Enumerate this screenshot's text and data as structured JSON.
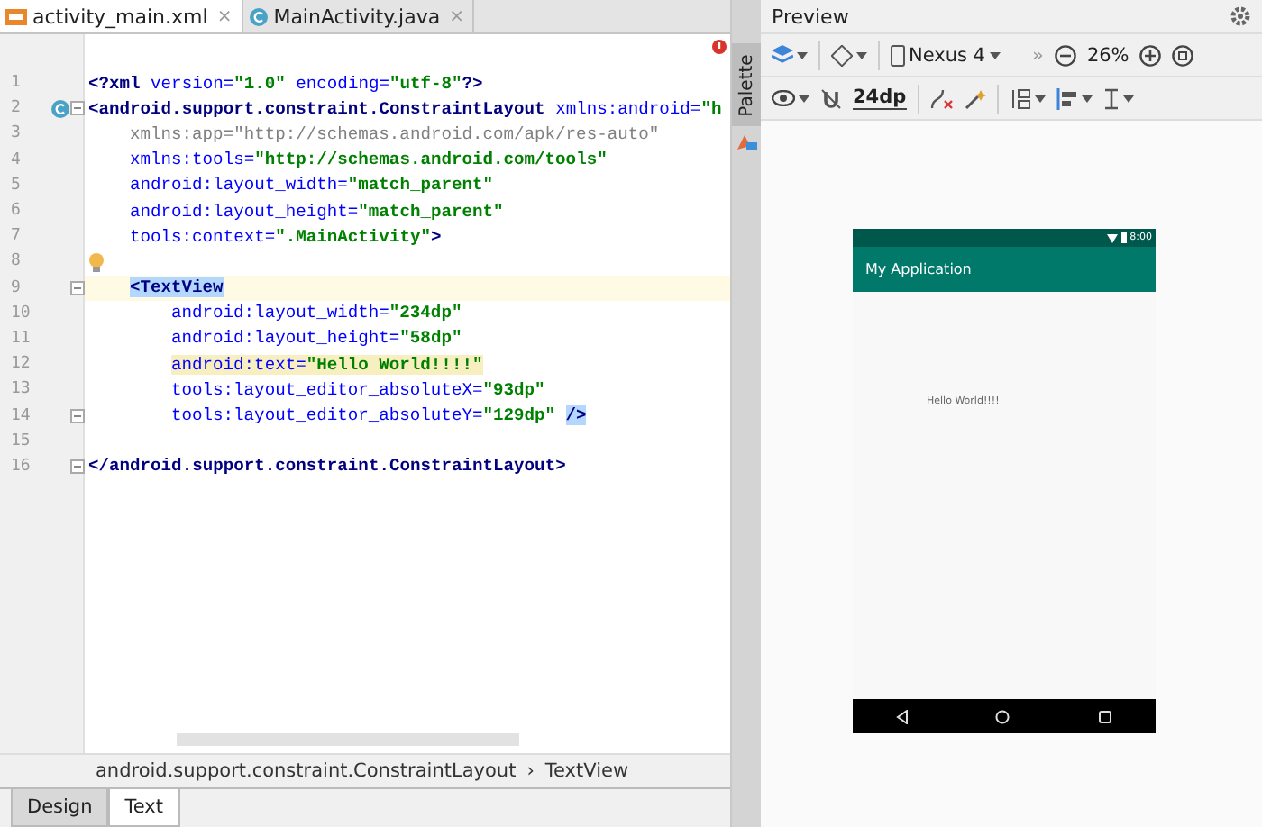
{
  "editor_tabs": [
    {
      "label": "activity_main.xml",
      "selected": true,
      "close": "×"
    },
    {
      "label": "MainActivity.java",
      "selected": false,
      "close": "×"
    }
  ],
  "code": {
    "lines": [
      {
        "number": "1",
        "kind": "root",
        "current": false,
        "class_marker": false,
        "fold": false,
        "bulb": false,
        "segments": [
          {
            "kind": "tag",
            "text": "<?xml "
          },
          {
            "kind": "attr",
            "text": "version="
          },
          {
            "kind": "value",
            "text": "\"1.0\" "
          },
          {
            "kind": "attr",
            "text": "encoding="
          },
          {
            "kind": "value",
            "text": "\"utf-8\""
          },
          {
            "kind": "tag",
            "text": "?>"
          }
        ]
      },
      {
        "number": "2",
        "kind": "root",
        "current": false,
        "class_marker": true,
        "fold": true,
        "bulb": false,
        "segments": [
          {
            "kind": "tag",
            "text": "<android.support.constraint.ConstraintLayout "
          },
          {
            "kind": "attr",
            "text": "xmlns:android="
          },
          {
            "kind": "value",
            "text": "\"h"
          }
        ]
      },
      {
        "number": "3",
        "kind": "attribute",
        "current": false,
        "class_marker": false,
        "fold": false,
        "bulb": false,
        "segments": [
          {
            "kind": "unused",
            "text": "xmlns:app=\"http://schemas.android.com/apk/res-auto\""
          }
        ]
      },
      {
        "number": "4",
        "kind": "attribute",
        "current": false,
        "class_marker": false,
        "fold": false,
        "bulb": false,
        "segments": [
          {
            "kind": "attr",
            "text": "xmlns:tools="
          },
          {
            "kind": "value",
            "text": "\"http://schemas.android.com/tools\""
          }
        ]
      },
      {
        "number": "5",
        "kind": "attribute",
        "current": false,
        "class_marker": false,
        "fold": false,
        "bulb": false,
        "segments": [
          {
            "kind": "attr",
            "text": "android:layout_width="
          },
          {
            "kind": "value",
            "text": "\"match_parent\""
          }
        ]
      },
      {
        "number": "6",
        "kind": "attribute",
        "current": false,
        "class_marker": false,
        "fold": false,
        "bulb": false,
        "segments": [
          {
            "kind": "attr",
            "text": "android:layout_height="
          },
          {
            "kind": "value",
            "text": "\"match_parent\""
          }
        ]
      },
      {
        "number": "7",
        "kind": "attribute",
        "current": false,
        "class_marker": false,
        "fold": false,
        "bulb": false,
        "segments": [
          {
            "kind": "attr",
            "text": "tools:context="
          },
          {
            "kind": "value",
            "text": "\".MainActivity\""
          },
          {
            "kind": "tag",
            "text": ">"
          }
        ]
      },
      {
        "number": "8",
        "kind": "blank",
        "current": false,
        "class_marker": false,
        "fold": false,
        "bulb": true
      },
      {
        "number": "9",
        "kind": "child",
        "current": true,
        "class_marker": false,
        "fold": true,
        "bulb": false,
        "segments": [
          {
            "kind": "tag_selected",
            "text": "<TextView"
          }
        ]
      },
      {
        "number": "10",
        "kind": "child_attribute",
        "current": false,
        "class_marker": false,
        "fold": false,
        "bulb": false,
        "segments": [
          {
            "kind": "attr",
            "text": "android:layout_width="
          },
          {
            "kind": "value",
            "text": "\"234dp\""
          }
        ]
      },
      {
        "number": "11",
        "kind": "child_attribute",
        "current": false,
        "class_marker": false,
        "fold": false,
        "bulb": false,
        "segments": [
          {
            "kind": "attr",
            "text": "android:layout_height="
          },
          {
            "kind": "value",
            "text": "\"58dp\""
          }
        ]
      },
      {
        "number": "12",
        "kind": "child_attribute",
        "current": false,
        "class_marker": false,
        "fold": false,
        "bulb": false,
        "segments": [
          {
            "kind": "attr_warning",
            "text": "android:text="
          },
          {
            "kind": "value_warning",
            "text": "\"Hello World!!!!\""
          }
        ]
      },
      {
        "number": "13",
        "kind": "child_attribute",
        "current": false,
        "class_marker": false,
        "fold": false,
        "bulb": false,
        "segments": [
          {
            "kind": "attr",
            "text": "tools:layout_editor_absoluteX="
          },
          {
            "kind": "value",
            "text": "\"93dp\""
          }
        ]
      },
      {
        "number": "14",
        "kind": "child_attribute",
        "current": false,
        "class_marker": false,
        "fold": true,
        "bulb": false,
        "segments": [
          {
            "kind": "attr",
            "text": "tools:layout_editor_absoluteY="
          },
          {
            "kind": "value",
            "text": "\"129dp\" "
          },
          {
            "kind": "tag_selected",
            "text": "/>"
          }
        ]
      },
      {
        "number": "15",
        "kind": "blank",
        "current": false,
        "class_marker": false,
        "fold": false,
        "bulb": false
      },
      {
        "number": "16",
        "kind": "root",
        "current": false,
        "class_marker": false,
        "fold": true,
        "bulb": false,
        "segments": [
          {
            "kind": "tag",
            "text": "</android.support.constraint.ConstraintLayout>"
          }
        ]
      }
    ]
  },
  "breadcrumb": [
    "android.support.constraint.ConstraintLayout",
    "TextView"
  ],
  "breadcrumb_separator": "›",
  "bottom_tabs": [
    {
      "label": "Design",
      "selected": false
    },
    {
      "label": "Text",
      "selected": true
    }
  ],
  "preview": {
    "title": "Preview",
    "palette_label": "Palette",
    "device": "Nexus 4",
    "overflow": "»",
    "zoom": "26%",
    "margin": "24dp",
    "phone": {
      "time": "8:00",
      "app_title": "My Application",
      "text": "Hello World!!!!"
    }
  }
}
